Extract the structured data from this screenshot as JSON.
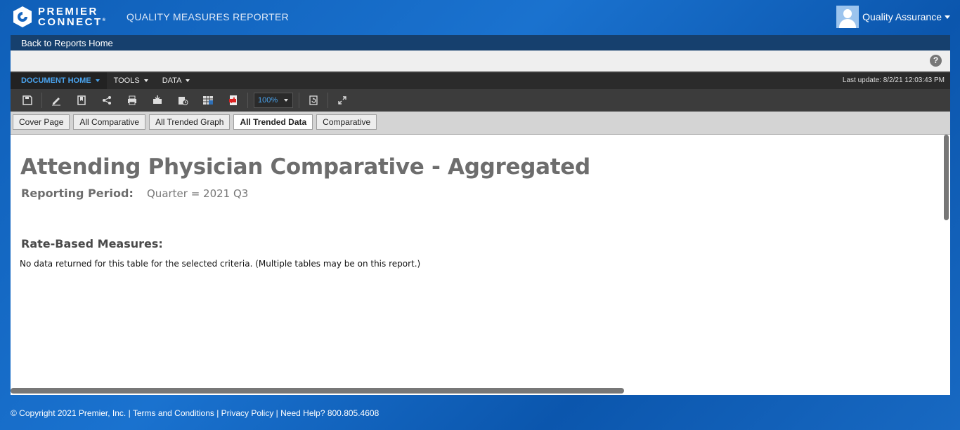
{
  "header": {
    "logo_line1": "PREMIER",
    "logo_line2": "CONNECT",
    "logo_mark": "®",
    "app_title": "QUALITY MEASURES REPORTER",
    "user_name": "Quality Assurance"
  },
  "nav": {
    "back_label": "Back to Reports Home"
  },
  "menu": {
    "items": [
      {
        "label": "DOCUMENT HOME"
      },
      {
        "label": "TOOLS"
      },
      {
        "label": "DATA"
      }
    ],
    "last_update": "Last update: 8/2/21 12:03:43 PM"
  },
  "toolbar": {
    "icons": [
      "save-icon",
      "edit-icon",
      "bookmark-icon",
      "share-icon",
      "print-icon",
      "export-icon",
      "schedule-icon",
      "excel-icon",
      "pdf-icon",
      "refresh-icon",
      "fullscreen-icon"
    ],
    "zoom": "100%"
  },
  "tabs": [
    {
      "label": "Cover Page"
    },
    {
      "label": "All Comparative"
    },
    {
      "label": "All Trended Graph"
    },
    {
      "label": "All Trended Data"
    },
    {
      "label": "Comparative"
    }
  ],
  "report": {
    "title": "Attending Physician Comparative - Aggregated",
    "period_label": "Reporting Period:",
    "period_value": "Quarter = 2021 Q3",
    "section_title": "Rate-Based Measures:",
    "no_data_message": "No data returned for this table for the selected criteria. (Multiple tables may be on this report.)"
  },
  "footer": {
    "text": "© Copyright 2021 Premier, Inc. | Terms and Conditions | Privacy Policy | Need Help? 800.805.4608"
  },
  "colors": {
    "brand_blue": "#1565c0",
    "nav_dark": "#16406e",
    "menu_active": "#4aa4ef"
  }
}
